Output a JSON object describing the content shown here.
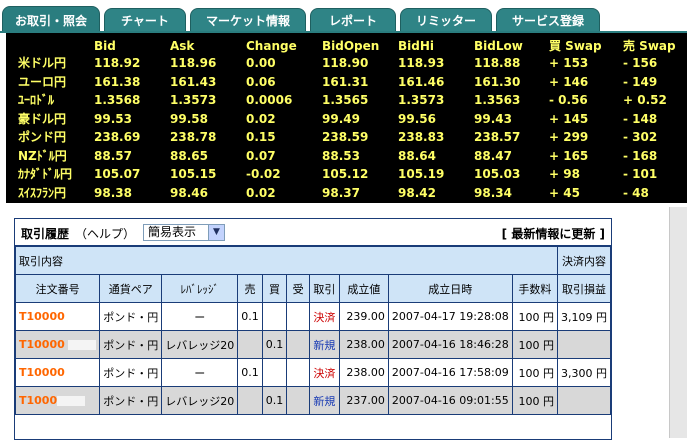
{
  "tabs": [
    {
      "label": "お取引・照会",
      "active": true
    },
    {
      "label": "チャート",
      "active": false
    },
    {
      "label": "マーケット情報",
      "active": false
    },
    {
      "label": "レポート",
      "active": false
    },
    {
      "label": "リミッター",
      "active": false
    },
    {
      "label": "サービス登録",
      "active": false
    }
  ],
  "quotes": {
    "headers": [
      "Bid",
      "Ask",
      "Change",
      "BidOpen",
      "BidHi",
      "BidLow",
      "買 Swap",
      "売 Swap"
    ],
    "rows": [
      {
        "pair": "米ドル円",
        "values": [
          "118.92",
          "118.96",
          "0.00",
          "118.90",
          "118.93",
          "118.88",
          "+ 153",
          "- 156"
        ]
      },
      {
        "pair": "ユーロ円",
        "values": [
          "161.38",
          "161.43",
          "0.06",
          "161.31",
          "161.46",
          "161.30",
          "+ 146",
          "- 149"
        ]
      },
      {
        "pair": "ﾕｰﾛﾄﾞﾙ",
        "values": [
          "1.3568",
          "1.3573",
          "0.0006",
          "1.3565",
          "1.3573",
          "1.3563",
          "- 0.56",
          "+ 0.52"
        ]
      },
      {
        "pair": "豪ドル円",
        "values": [
          "99.53",
          "99.58",
          "0.02",
          "99.49",
          "99.56",
          "99.43",
          "+ 145",
          "- 148"
        ]
      },
      {
        "pair": "ポンド円",
        "values": [
          "238.69",
          "238.78",
          "0.15",
          "238.59",
          "238.83",
          "238.57",
          "+ 299",
          "- 302"
        ]
      },
      {
        "pair": "NZﾄﾞﾙ円",
        "values": [
          "88.57",
          "88.65",
          "0.07",
          "88.53",
          "88.64",
          "88.47",
          "+ 165",
          "- 168"
        ]
      },
      {
        "pair": "ｶﾅﾀﾞﾄﾞﾙ円",
        "values": [
          "105.07",
          "105.15",
          "-0.02",
          "105.12",
          "105.19",
          "105.03",
          "+ 98",
          "- 101"
        ]
      },
      {
        "pair": "ｽｲｽﾌﾗﾝ円",
        "values": [
          "98.38",
          "98.46",
          "0.02",
          "98.37",
          "98.42",
          "98.34",
          "+ 45",
          "- 48"
        ]
      }
    ]
  },
  "history": {
    "title": "取引履歴",
    "help": "（ヘルプ）",
    "view_select": "簡易表示",
    "refresh": "[ 最新情報に更新 ]",
    "group_left": "取引内容",
    "group_right": "決済内容",
    "columns": [
      "注文番号",
      "通貨ペア",
      "ﾚﾊﾞﾚｯｼﾞ",
      "売",
      "買",
      "受",
      "取引",
      "成立値",
      "成立日時",
      "手数料",
      "取引損益"
    ],
    "rows": [
      {
        "order": "T10000",
        "pair": "ポンド・円",
        "leverage": "ー",
        "sell": "0.1",
        "buy": "",
        "recv": "",
        "type": "決済",
        "price": "239.00",
        "datetime": "2007-04-17 19:28:08",
        "fee": "100 円",
        "pl": "3,109 円"
      },
      {
        "order": "T10000",
        "pair": "ポンド・円",
        "leverage": "レバレッジ20",
        "sell": "",
        "buy": "0.1",
        "recv": "",
        "type": "新規",
        "price": "238.00",
        "datetime": "2007-04-16 18:46:28",
        "fee": "100 円",
        "pl": ""
      },
      {
        "order": "T10000",
        "pair": "ポンド・円",
        "leverage": "ー",
        "sell": "0.1",
        "buy": "",
        "recv": "",
        "type": "決済",
        "price": "238.00",
        "datetime": "2007-04-16 17:58:09",
        "fee": "100 円",
        "pl": "3,300 円"
      },
      {
        "order": "T1000",
        "pair": "ポンド・円",
        "leverage": "レバレッジ20",
        "sell": "",
        "buy": "0.1",
        "recv": "",
        "type": "新規",
        "price": "237.00",
        "datetime": "2007-04-16 09:01:55",
        "fee": "100 円",
        "pl": ""
      }
    ]
  }
}
